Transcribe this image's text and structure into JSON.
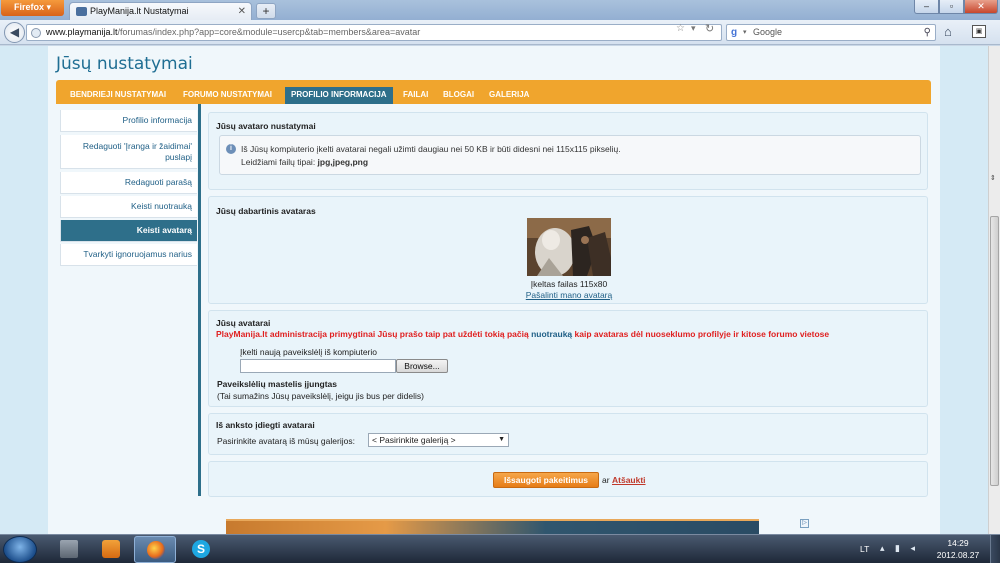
{
  "browser": {
    "app_menu": "Firefox",
    "tab_title": "PlayManija.lt Nustatymai",
    "new_tab": "+",
    "url_domain": "www.playmanija.lt",
    "url_path": "/forumas/index.php?app=core&module=usercp&tab=members&area=avatar",
    "search_placeholder": "Google"
  },
  "page": {
    "title": "Jūsų nustatymai",
    "tabs": [
      {
        "label": "BENDRIEJI NUSTATYMAI"
      },
      {
        "label": "FORUMO NUSTATYMAI"
      },
      {
        "label": "PROFILIO INFORMACIJA",
        "active": true
      },
      {
        "label": "FAILAI"
      },
      {
        "label": "BLOGAI"
      },
      {
        "label": "GALERIJA"
      }
    ],
    "sidebar": [
      {
        "label": "Profilio informacija"
      },
      {
        "label": "Redaguoti 'Įranga ir žaidimai' puslapį"
      },
      {
        "label": "Redaguoti parašą"
      },
      {
        "label": "Keisti nuotrauką"
      },
      {
        "label": "Keisti avatarą",
        "active": true
      },
      {
        "label": "Tvarkyti ignoruojamus narius"
      }
    ],
    "settings": {
      "title": "Jūsų avataro nustatymai",
      "info_line1": "Iš Jūsų kompiuterio įkelti avatarai negali užimti daugiau nei 50 KB ir būti didesni nei 115x115 pikselių.",
      "info_line2_prefix": "Leidžiami failų tipai: ",
      "info_line2_types": "jpg,jpeg,png"
    },
    "current": {
      "title": "Jūsų dabartinis avataras",
      "caption": "Įkeltas failas 115x80",
      "remove_link": "Pašalinti mano avatarą"
    },
    "upload": {
      "title": "Jūsų avatarai",
      "notice_a": "PlayManija.lt administracija primygtinai Jūsų prašo taip pat uždėti tokią pačią ",
      "notice_link": "nuotrauką",
      "notice_b": " kaip avataras dėl nuoseklumo profilyje ir kitose forumo vietose",
      "upload_label": "Įkelti naują paveikslėlį iš kompiuterio",
      "browse_label": "Browse...",
      "scale_label": "Paveikslėlių mastelis įjungtas",
      "scale_desc": "(Tai sumažins Jūsų paveikslėlį, jeigu jis bus per didelis)"
    },
    "gallery": {
      "title": "Iš anksto įdiegti avatarai",
      "label": "Pasirinkite avatarą iš mūsų galerijos:",
      "selected": "< Pasirinkite galeriją >"
    },
    "actions": {
      "save": "Išsaugoti pakeitimus",
      "or": "ar",
      "cancel": "Atšaukti"
    }
  },
  "taskbar": {
    "language": "LT",
    "time": "14:29",
    "date": "2012.08.27"
  },
  "colors": {
    "accent": "#f0a52d",
    "active_tab": "#2e6f8a",
    "title": "#1f6e93",
    "notice": "#e02020"
  }
}
